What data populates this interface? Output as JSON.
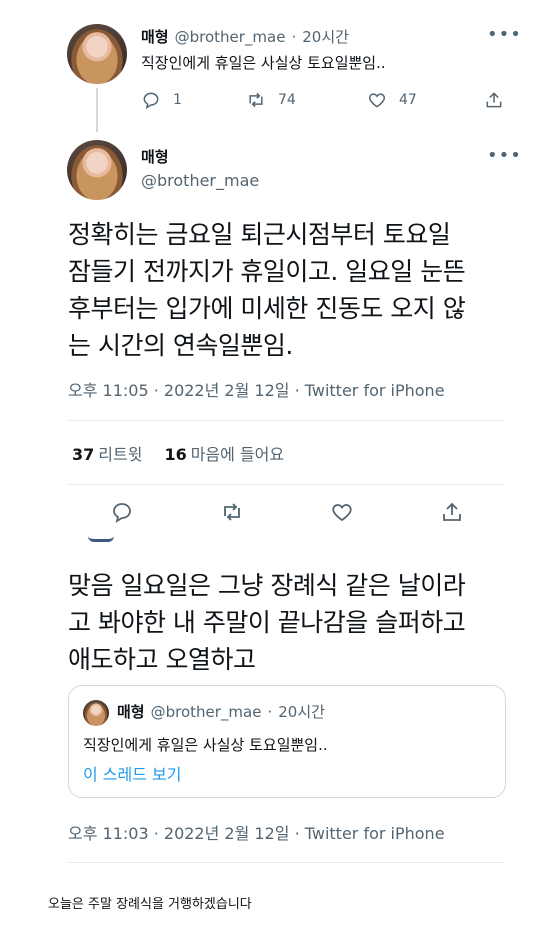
{
  "reply_tweet": {
    "name": "매형",
    "handle": "@brother_mae",
    "sep": "·",
    "time": "20시간",
    "more": "•••",
    "text": "직장인에게 휴일은 사실상 토요일뿐임..",
    "actions": {
      "reply_count": "1",
      "retweet_count": "74",
      "like_count": "47"
    }
  },
  "main_tweet": {
    "name": "매형",
    "handle": "@brother_mae",
    "more": "•••",
    "text_lines": [
      "정확히는 금요일 퇴근시점부터 토요일",
      "잠들기 전까지가 휴일이고. 일요일 눈뜬",
      "후부터는 입가에 미세한 진동도 오지 않",
      "는 시간의 연속일뿐임."
    ],
    "meta": "오후 11:05 · 2022년 2월 12일 · Twitter for iPhone",
    "stats": {
      "retweets_count": "37",
      "retweets_label": "리트윗",
      "likes_count": "16",
      "likes_label": "마음에 들어요"
    }
  },
  "quote_tweet": {
    "text_lines": [
      "맞음 일요일은 그냥 장례식 같은 날이라",
      "고 봐야한 내 주말이 끝나감을 슬퍼하고",
      "애도하고 오열하고"
    ],
    "quoted": {
      "name": "매형",
      "handle": "@brother_mae",
      "sep": "·",
      "time": "20시간",
      "text": "직장인에게 휴일은 사실상 토요일뿐임..",
      "link": "이 스레드 보기"
    },
    "meta": "오후 11:03 · 2022년 2월 12일 · Twitter for iPhone"
  },
  "caption": "오늘은 주말 장례식을 거행하겠습니다",
  "colors": {
    "text": "#0f1419",
    "secondary": "#536471",
    "link": "#1d9bf0",
    "border": "#cfd9de"
  }
}
